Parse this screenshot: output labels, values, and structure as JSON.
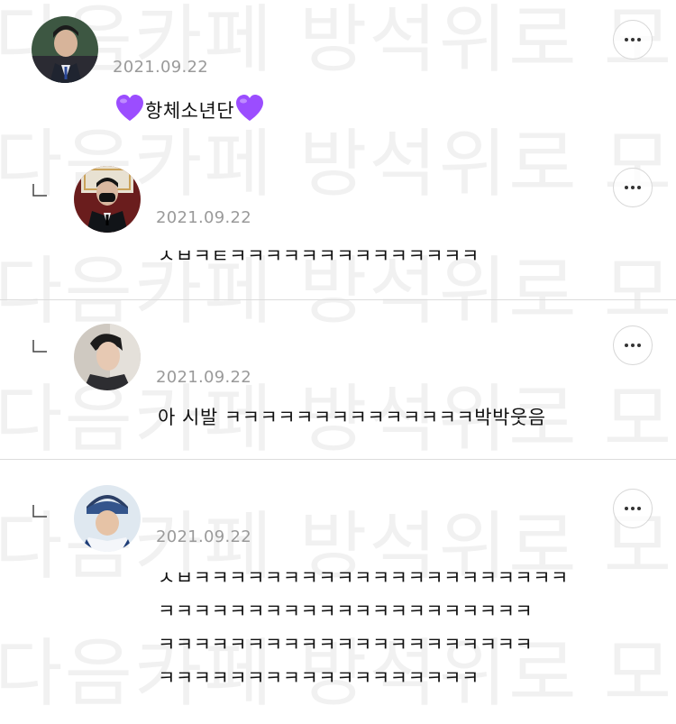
{
  "watermark": "다음카페 방석위로 모여라 불펌금지",
  "comments": [
    {
      "date": "2021.09.22",
      "text_emoji_left": "purple-heart",
      "text": "항체소년단",
      "text_emoji_right": "purple-heart",
      "is_reply": false
    },
    {
      "date": "2021.09.22",
      "text": "ㅅㅂㅋㅌㅋㅋㅋㅋㅋㅋㅋㅋㅋㅋㅋㅋㅋㅋ",
      "is_reply": true
    },
    {
      "date": "2021.09.22",
      "text": "아 시발 ㅋㅋㅋㅋㅋㅋㅋㅋㅋㅋㅋㅋㅋㅋ박박웃음",
      "is_reply": true
    },
    {
      "date": "2021.09.22",
      "lines": [
        "ㅅㅂㅋㅋㅋㅋㅋㅋㅋㅋㅋㅋㅋㅋㅋㅋㅋㅋㅋㅋㅋㅋㅋ",
        "ㅋㅋㅋㅋㅋㅋㅋㅋㅋㅋㅋㅋㅋㅋㅋㅋㅋㅋㅋㅋㅋ",
        "ㅋㅋㅋㅋㅋㅋㅋㅋㅋㅋㅋㅋㅋㅋㅋㅋㅋㅋㅋㅋㅋ",
        "ㅋㅋㅋㅋㅋㅋㅋㅋㅋㅋㅋㅋㅋㅋㅋㅋㅋㅋ"
      ],
      "is_reply": true
    }
  ],
  "colors": {
    "date": "#9a9a9a",
    "divider": "#dcdcdc",
    "heart": "#9b4dff"
  }
}
